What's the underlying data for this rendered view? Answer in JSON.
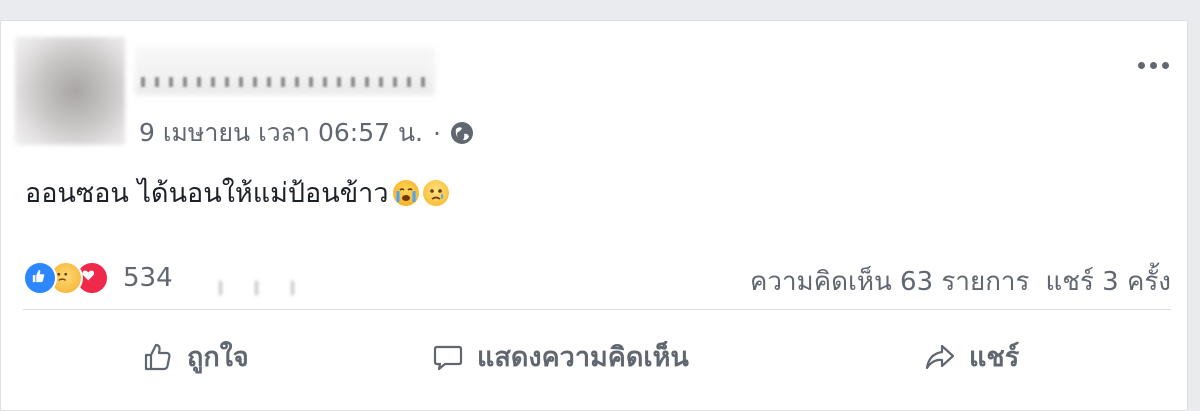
{
  "post": {
    "timestamp": "9 เมษายน เวลา 06:57 น.",
    "separator": "·",
    "text": "ออนซอน ได้นอนให้แม่ป้อนข้าว",
    "reactions_count": "534",
    "comments": "ความคิดเห็น 63 รายการ",
    "shares": "แชร์ 3 ครั้ง"
  },
  "actions": {
    "like": "ถูกใจ",
    "comment": "แสดงความคิดเห็น",
    "share": "แชร์"
  },
  "icons": {
    "privacy": "globe-icon",
    "more": "more-options-icon",
    "like": "thumbs-up-icon",
    "comment": "comment-bubble-icon",
    "share": "share-arrow-icon",
    "emojis": [
      "crying-face-emoji",
      "sad-face-emoji"
    ],
    "reactions": [
      "like-reaction-icon",
      "sad-reaction-icon",
      "love-reaction-icon"
    ]
  },
  "colors": {
    "like_blue": "#2d88ff",
    "love_red": "#f0284a",
    "secondary_text": "#606770"
  }
}
